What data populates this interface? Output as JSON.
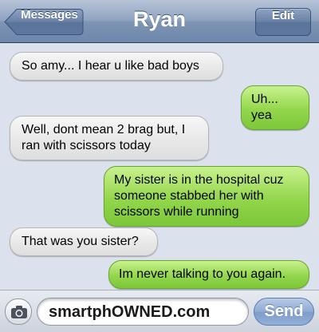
{
  "navbar": {
    "back_label": "Messages",
    "title": "Ryan",
    "edit_label": "Edit"
  },
  "messages": [
    {
      "direction": "received",
      "text": "So amy... I hear u like bad boys"
    },
    {
      "direction": "sent",
      "text": "Uh... yea"
    },
    {
      "direction": "received",
      "text": "Well, dont mean 2 brag but, I ran with scissors today"
    },
    {
      "direction": "sent",
      "text": "My sister is in the hospital cuz someone stabbed her with scissors while running"
    },
    {
      "direction": "received",
      "text": "That was you sister?"
    },
    {
      "direction": "sent",
      "text": "Im never talking to you again."
    }
  ],
  "input_bar": {
    "camera_icon": "camera-icon",
    "field_value": "smartphOWNED.com",
    "send_label": "Send"
  },
  "colors": {
    "navbar": "#7f95b5",
    "sent_bubble": "#93d64c",
    "received_bubble": "#e8e8e8",
    "background": "#dbe2ed"
  }
}
